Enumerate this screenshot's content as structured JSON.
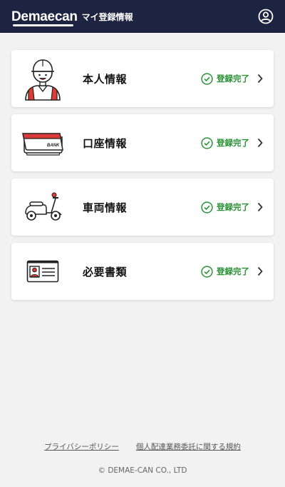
{
  "header": {
    "logo": "Demaecan",
    "title": "マイ登録情報",
    "account_icon": "account-circle-icon"
  },
  "cards": [
    {
      "label": "本人情報",
      "status": "登録完了",
      "illustration": "delivery-person-icon"
    },
    {
      "label": "口座情報",
      "status": "登録完了",
      "illustration": "bankbook-icon",
      "bank_text": "BANK"
    },
    {
      "label": "車両情報",
      "status": "登録完了",
      "illustration": "scooter-icon"
    },
    {
      "label": "必要書類",
      "status": "登録完了",
      "illustration": "id-card-icon"
    }
  ],
  "footer": {
    "privacy_link": "プライバシーポリシー",
    "terms_link": "個人配達業務委託に関する規約",
    "copyright": "© DEMAE-CAN CO., LTD"
  },
  "colors": {
    "header_bg": "#1d2340",
    "status_green": "#2b9137",
    "bank_red": "#d93a3a",
    "accent_red": "#e03a32"
  }
}
